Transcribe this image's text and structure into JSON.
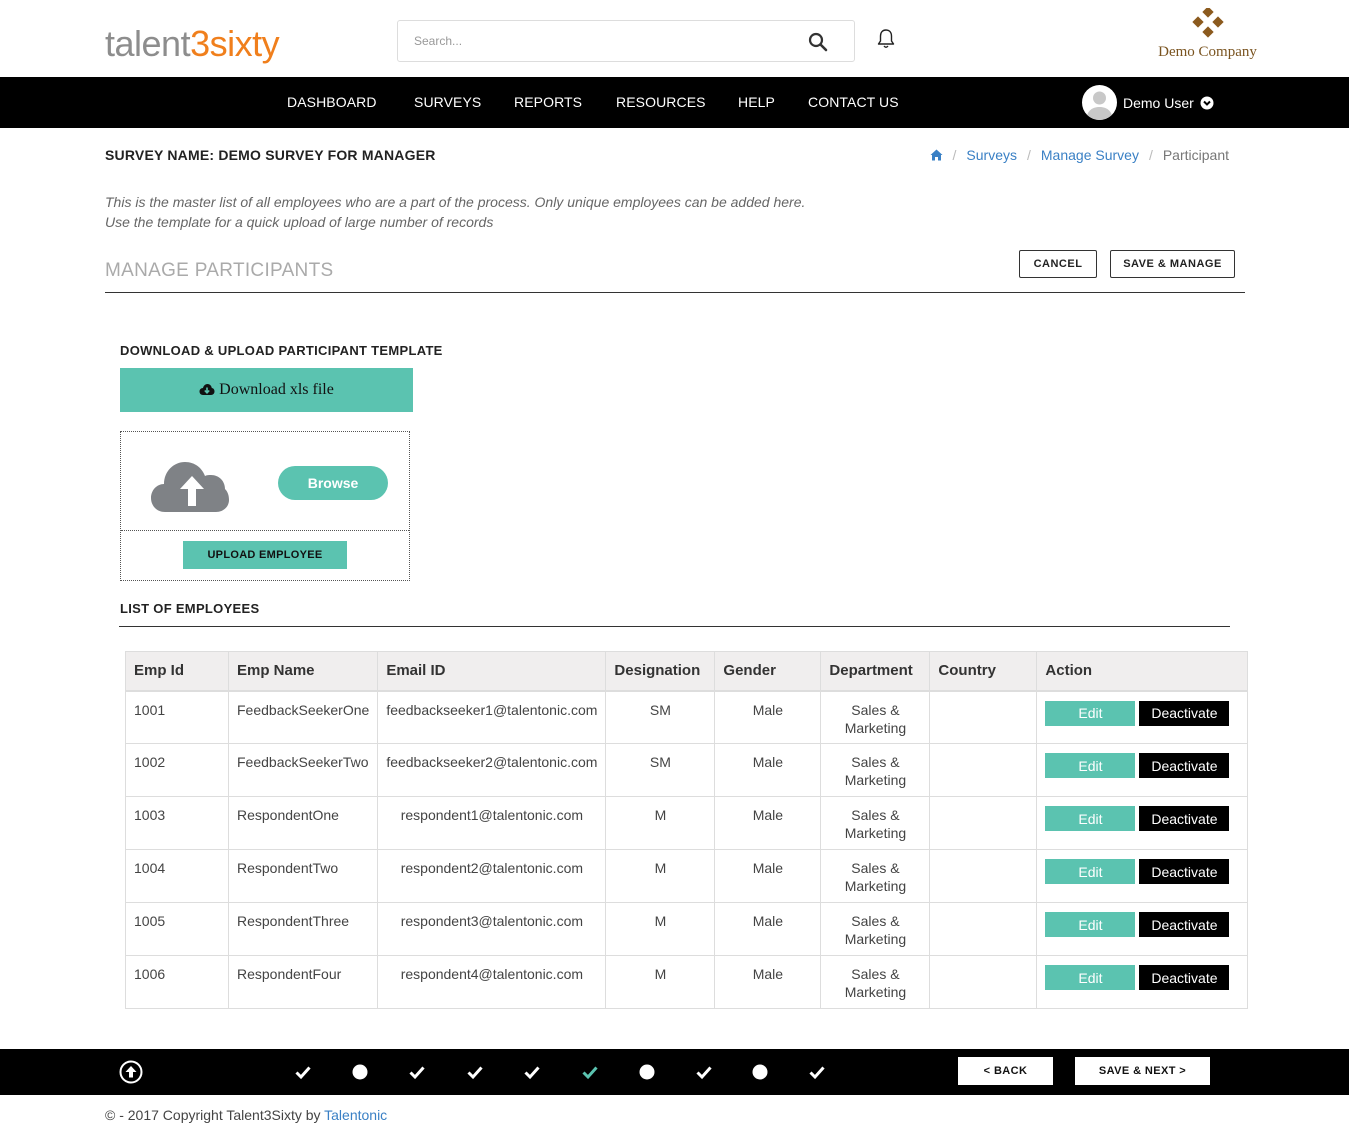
{
  "header": {
    "logo_part1": "talent",
    "logo_part2": "3sixty",
    "search_placeholder": "Search...",
    "company_name": "Demo Company"
  },
  "nav": {
    "items": [
      "DASHBOARD",
      "SURVEYS",
      "REPORTS",
      "RESOURCES",
      "HELP",
      "CONTACT US"
    ],
    "user_name": "Demo User"
  },
  "page": {
    "survey_name": "SURVEY NAME: DEMO SURVEY FOR MANAGER",
    "breadcrumb": [
      "Surveys",
      "Manage Survey",
      "Participant"
    ],
    "description_line1": "This is the master list of all employees who are a part of the process. Only unique employees can be added here.",
    "description_line2": "Use the template for a quick upload of large number of records",
    "manage_title": "MANAGE PARTICIPANTS",
    "cancel_label": "CANCEL",
    "save_manage_label": "SAVE & MANAGE",
    "template_title": "DOWNLOAD & UPLOAD PARTICIPANT TEMPLATE",
    "download_label": "Download xls file",
    "browse_label": "Browse",
    "upload_label": "UPLOAD EMPLOYEE",
    "list_title": "LIST OF EMPLOYEES"
  },
  "table": {
    "headers": [
      "Emp Id",
      "Emp Name",
      "Email ID",
      "Designation",
      "Gender",
      "Department",
      "Country",
      "Action"
    ],
    "edit_label": "Edit",
    "deactivate_label": "Deactivate",
    "rows": [
      {
        "id": "1001",
        "name": "FeedbackSeekerOne",
        "email": "feedbackseeker1@talentonic.com",
        "designation": "SM",
        "gender": "Male",
        "dept1": "Sales &",
        "dept2": "Marketing",
        "country": ""
      },
      {
        "id": "1002",
        "name": "FeedbackSeekerTwo",
        "email": "feedbackseeker2@talentonic.com",
        "designation": "SM",
        "gender": "Male",
        "dept1": "Sales &",
        "dept2": "Marketing",
        "country": ""
      },
      {
        "id": "1003",
        "name": "RespondentOne",
        "email": "respondent1@talentonic.com",
        "designation": "M",
        "gender": "Male",
        "dept1": "Sales &",
        "dept2": "Marketing",
        "country": ""
      },
      {
        "id": "1004",
        "name": "RespondentTwo",
        "email": "respondent2@talentonic.com",
        "designation": "M",
        "gender": "Male",
        "dept1": "Sales &",
        "dept2": "Marketing",
        "country": ""
      },
      {
        "id": "1005",
        "name": "RespondentThree",
        "email": "respondent3@talentonic.com",
        "designation": "M",
        "gender": "Male",
        "dept1": "Sales &",
        "dept2": "Marketing",
        "country": ""
      },
      {
        "id": "1006",
        "name": "RespondentFour",
        "email": "respondent4@talentonic.com",
        "designation": "M",
        "gender": "Male",
        "dept1": "Sales &",
        "dept2": "Marketing",
        "country": ""
      }
    ]
  },
  "footer_bar": {
    "steps": [
      "check",
      "dot",
      "check",
      "check",
      "check",
      "check-active",
      "dot",
      "check",
      "dot",
      "check"
    ],
    "back_label": "< BACK",
    "next_label": "SAVE & NEXT >"
  },
  "copyright": {
    "text": "© - 2017 Copyright Talent3Sixty by ",
    "link": "Talentonic"
  },
  "colors": {
    "accent": "#5bc3b0",
    "logo_orange": "#f07f1c",
    "link_blue": "#3a80c5",
    "company_brown": "#7a5420"
  }
}
